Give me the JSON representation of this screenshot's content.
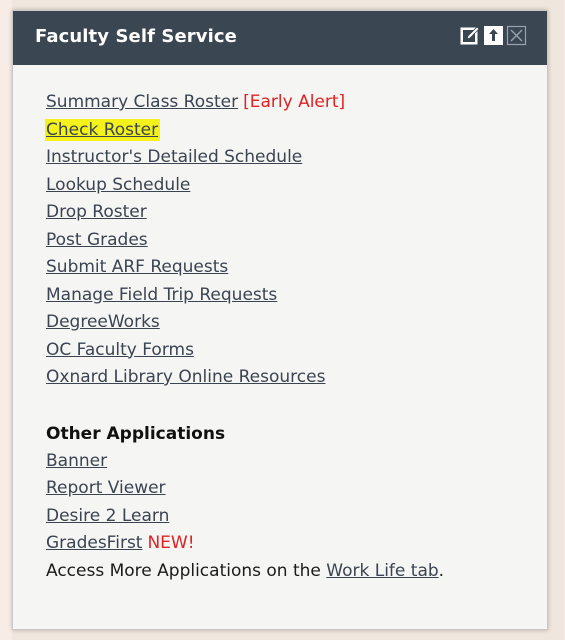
{
  "portlet": {
    "title": "Faculty Self Service",
    "icons": [
      "edit-icon",
      "upload-icon",
      "close-icon"
    ]
  },
  "faculty_links": [
    {
      "label": "Summary Class Roster",
      "badge": "[Early Alert]"
    },
    {
      "label": "Check Roster",
      "highlighted": true
    },
    {
      "label": "Instructor's Detailed Schedule"
    },
    {
      "label": "Lookup Schedule"
    },
    {
      "label": "Drop Roster"
    },
    {
      "label": "Post Grades"
    },
    {
      "label": "Submit ARF Requests"
    },
    {
      "label": "Manage Field Trip Requests"
    },
    {
      "label": "DegreeWorks"
    },
    {
      "label": "OC Faculty Forms"
    },
    {
      "label": "Oxnard Library Online Resources"
    }
  ],
  "other_apps": {
    "heading": "Other Applications",
    "links": [
      {
        "label": "Banner"
      },
      {
        "label": "Report Viewer"
      },
      {
        "label": "Desire 2 Learn"
      },
      {
        "label": "GradesFirst",
        "badge": "NEW!"
      }
    ],
    "more_text_prefix": "Access More Applications on the ",
    "more_link": "Work Life tab",
    "more_text_suffix": "."
  },
  "colors": {
    "header_bg": "#3a4652",
    "link": "#3b4452",
    "badge": "#e02222",
    "highlight": "#f4f21a"
  }
}
